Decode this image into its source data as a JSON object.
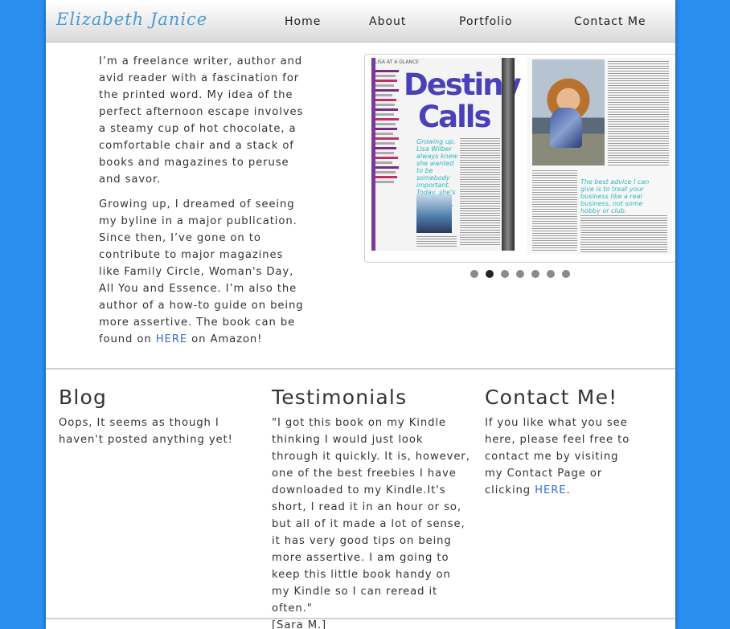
{
  "header": {
    "logo": "Elizabeth Janice",
    "nav": [
      {
        "label": "Home"
      },
      {
        "label": "About"
      },
      {
        "label": "Portfolio"
      },
      {
        "label": "Contact Me"
      }
    ]
  },
  "intro": {
    "p1": "I’m a freelance writer, author and avid reader with a fascination for the printed word. My idea of the perfect afternoon escape involves a steamy cup of hot chocolate, a comfortable chair and a stack of books and magazines to peruse and savor.",
    "p2_before": "Growing up, I dreamed of seeing my byline in a major publication. Since then, I’ve gone on to contribute to major magazines like Family Circle, Woman's Day, All You and Essence. I’m also the author of a how-to guide on being more assertive. The book can be found on ",
    "p2_link": "HERE",
    "p2_after": " on Amazon!"
  },
  "slideshow": {
    "magazine_heading_line1": "Destiny",
    "magazine_heading_line2": "Calls",
    "magazine_sidebar": "LISA AT A GLANCE",
    "magazine_pullquote": "Growing up, Lisa Wilber always knew she wanted to be somebody important. Today, she's gone beyond her wildest dreams!",
    "magazine_quote": "The best advice I can give is to treat your business like a real business, not some hobby or club.",
    "slide_count": 7,
    "active_index": 1
  },
  "blog": {
    "title": "Blog",
    "text": "Oops, It seems as though I haven't posted anything yet!"
  },
  "testimonials": {
    "title": "Testimonials",
    "quote": "\"I got this book on my Kindle thinking I would just look through it quickly. It is, however, one of the best freebies I have downloaded to my Kindle.It's short, I read it in an hour or so, but all of it made a lot of sense, it has very good tips on being more assertive. I am going to keep this little book handy on my Kindle so I can reread it often.\"",
    "author": "[Sara M.]"
  },
  "contact": {
    "title": "Contact Me!",
    "text_before": "If you like what you see here, please feel free to contact me by visiting my Contact Page or clicking ",
    "link": "HERE",
    "text_after": "."
  },
  "colors": {
    "background": "#2b8ff0",
    "logo": "#4a9ad8",
    "link": "#3a6fc4"
  }
}
